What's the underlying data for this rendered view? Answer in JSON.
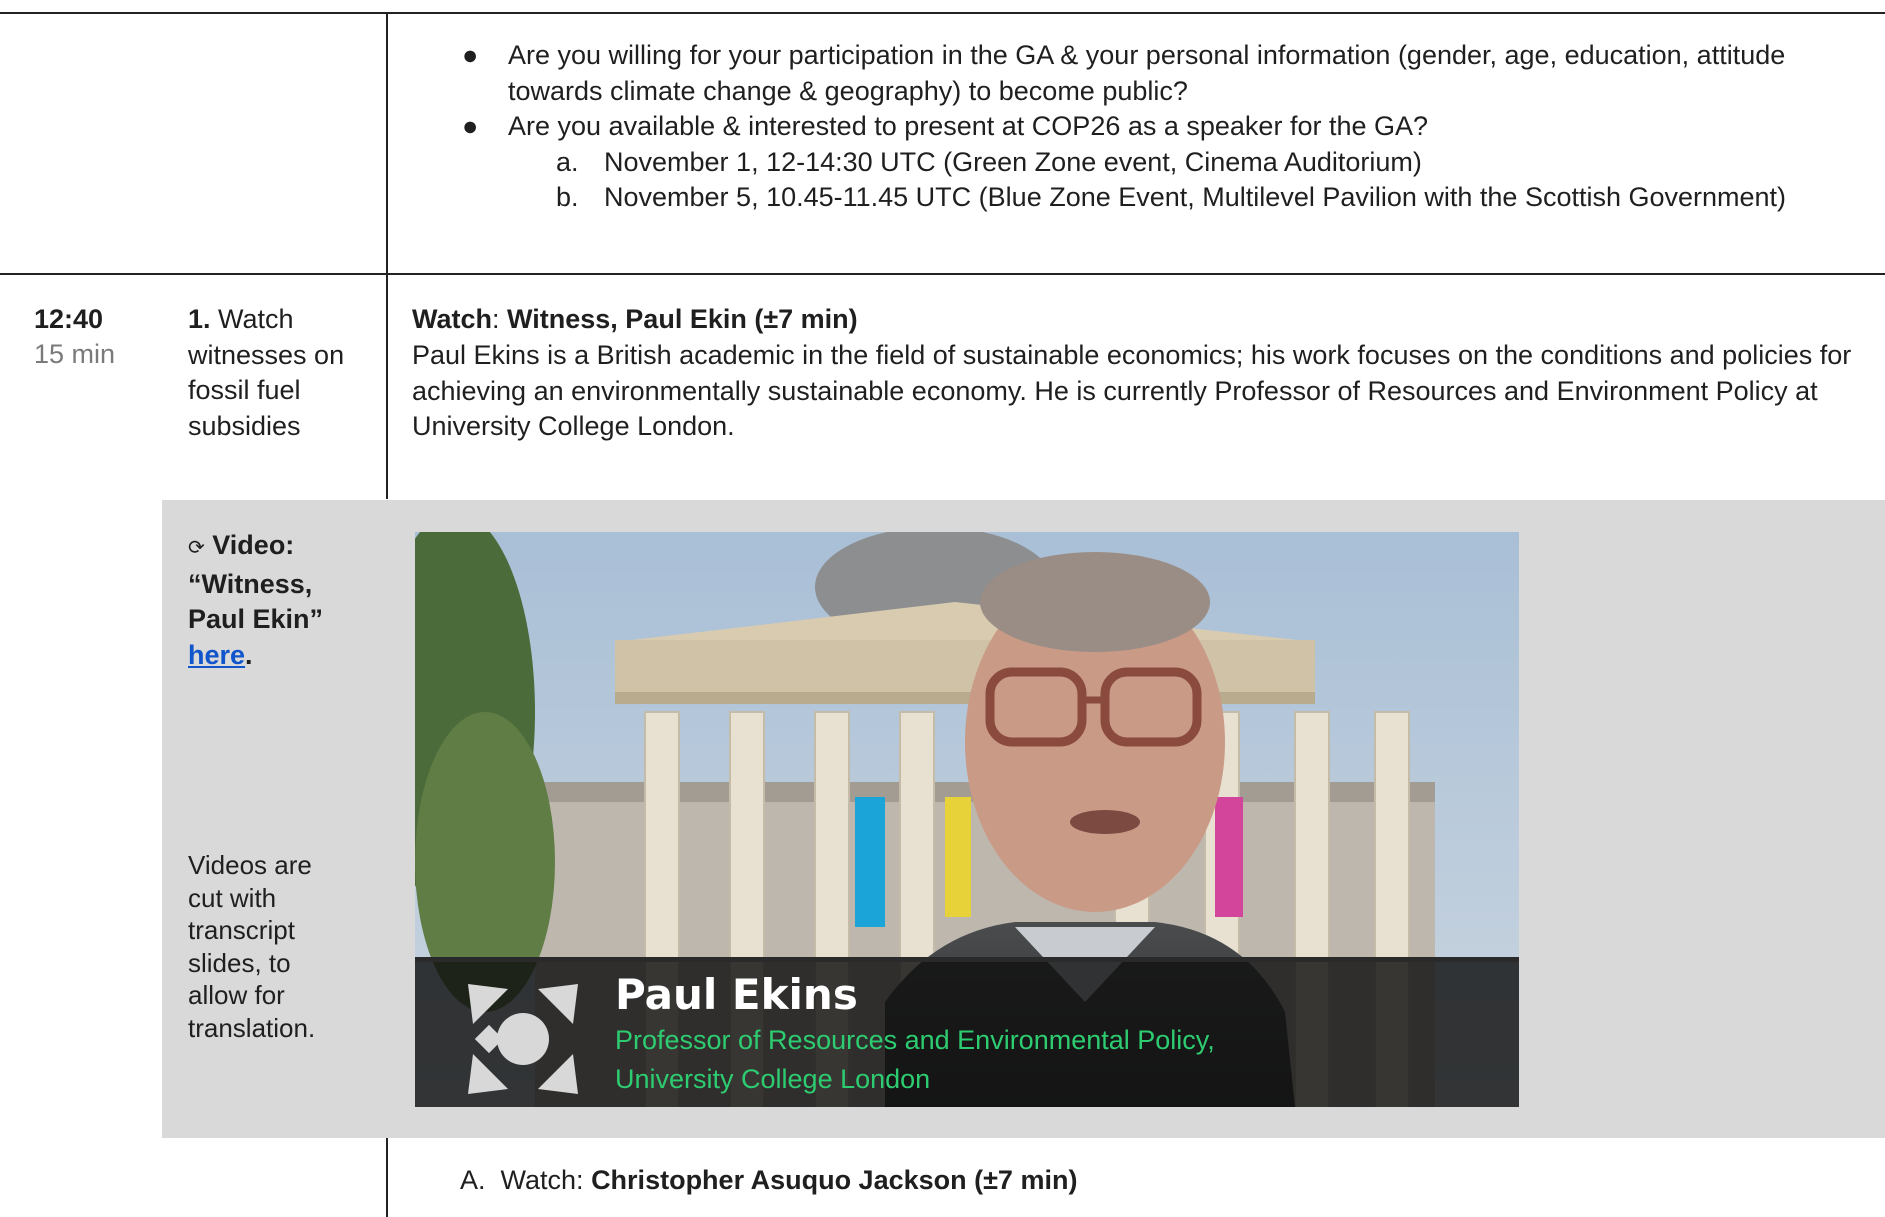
{
  "top_row": {
    "bullets": [
      {
        "marker": "●",
        "text": "Are you willing for your participation in the GA & your personal information (gender, age, education, attitude towards climate change & geography) to become public?"
      },
      {
        "marker": "●",
        "text": "Are you available & interested to present at COP26 as a speaker for the GA?"
      }
    ],
    "sub_items": [
      {
        "marker": "a.",
        "text": "November 1, 12-14:30 UTC (Green Zone event, Cinema Auditorium)"
      },
      {
        "marker": "b.",
        "text": "November 5, 10.45-11.45 UTC (Blue Zone Event, Multilevel Pavilion with the Scottish Government)"
      }
    ]
  },
  "session": {
    "time": "12:40",
    "duration": "15 min",
    "step_number": "1.",
    "step_text": "Watch witnesses on fossil fuel subsidies",
    "watch_prefix": "Watch",
    "watch_colon": ": ",
    "watch_title": "Witness, Paul Ekin (±7 min)",
    "description": "Paul Ekins is a British academic in the field of sustainable economics; his work focuses on the conditions and policies for achieving an environmentally sustainable economy. He is currently Professor of Resources and Environment Policy at University College London."
  },
  "video": {
    "icon": "⟳",
    "label": "Video: “Witness, Paul Ekin”",
    "link_text": "here",
    "period": ".",
    "note": "Videos are cut with transcript slides, to allow for translation.",
    "lower_third_name": "Paul Ekins",
    "lower_third_title_1": "Professor of Resources and Environmental Policy,",
    "lower_third_title_2": "University College London",
    "accent_color": "#2ecc71"
  },
  "next_item": {
    "marker": "A.",
    "prefix": "Watch: ",
    "title": "Christopher Asuquo Jackson (±7 min)"
  }
}
